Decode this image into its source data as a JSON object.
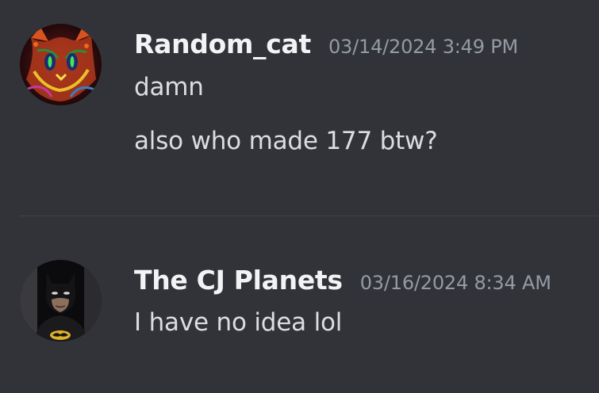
{
  "messages": [
    {
      "username": "Random_cat",
      "timestamp": "03/14/2024 3:49 PM",
      "avatar_icon": "psychedelic-cat-avatar",
      "lines": [
        "damn",
        "also who made 177 btw?"
      ]
    },
    {
      "username": "The CJ Planets",
      "timestamp": "03/16/2024 8:34 AM",
      "avatar_icon": "batman-avatar",
      "lines": [
        "I have no idea lol"
      ]
    }
  ],
  "colors": {
    "background": "#313338",
    "username": "#f2f3f5",
    "timestamp": "#949ba4",
    "message_text": "#dbdee1",
    "divider": "#3f4147"
  }
}
